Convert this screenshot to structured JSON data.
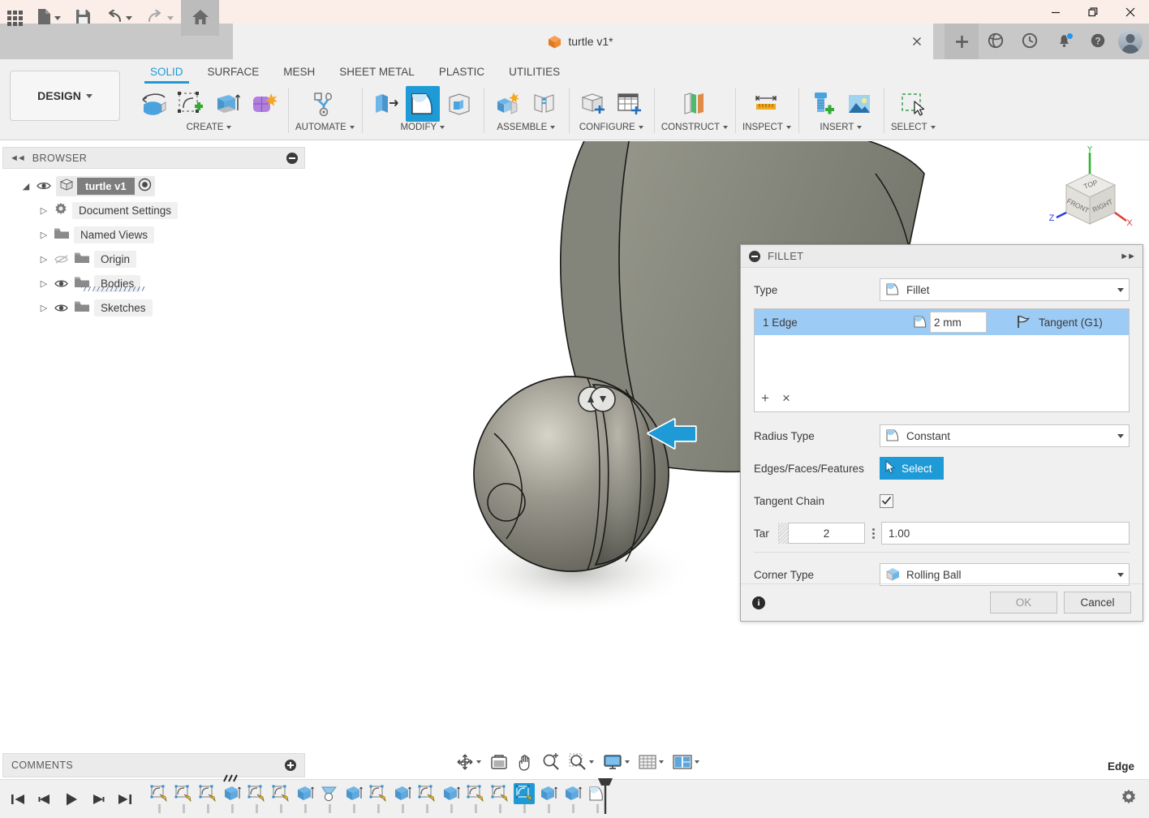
{
  "window": {
    "controls": [
      {
        "name": "minimize-button",
        "glyph": "minimize-icon"
      },
      {
        "name": "restore-button",
        "glyph": "restore-icon"
      },
      {
        "name": "close-button",
        "glyph": "close-icon"
      }
    ]
  },
  "quick_access": {
    "items": [
      {
        "name": "app-grid-button",
        "icon": "grid-apps-icon"
      },
      {
        "name": "new-file-button",
        "icon": "file-icon",
        "has_caret": true
      },
      {
        "name": "save-button",
        "icon": "save-disk-icon"
      },
      {
        "name": "undo-button",
        "icon": "undo-arrow-icon",
        "has_caret": true
      },
      {
        "name": "redo-button",
        "icon": "redo-arrow-icon",
        "has_caret": true
      },
      {
        "name": "home-button",
        "icon": "home-icon"
      }
    ],
    "right_items": [
      {
        "name": "new-tab-button",
        "icon": "plus-icon"
      },
      {
        "name": "data-panel-button",
        "icon": "globe-icon"
      },
      {
        "name": "job-status-button",
        "icon": "clock-icon"
      },
      {
        "name": "notifications-button",
        "icon": "bell-icon",
        "badge": true
      },
      {
        "name": "help-button",
        "icon": "question-mark-icon"
      },
      {
        "name": "account-avatar",
        "icon": "avatar-icon"
      }
    ]
  },
  "document_tab": {
    "title": "turtle v1*",
    "icon": "orange-cube-icon",
    "close_label": "×"
  },
  "ribbon": {
    "workspace": "DESIGN",
    "tabs": [
      {
        "label": "SOLID",
        "active": true
      },
      {
        "label": "SURFACE",
        "active": false
      },
      {
        "label": "MESH",
        "active": false
      },
      {
        "label": "SHEET METAL",
        "active": false
      },
      {
        "label": "PLASTIC",
        "active": false
      },
      {
        "label": "UTILITIES",
        "active": false
      }
    ],
    "groups": [
      {
        "name": "CREATE",
        "tools": [
          {
            "name": "revolve-tool",
            "icon": "revolve-icon",
            "active": false
          },
          {
            "name": "create-sketch-tool",
            "icon": "sketch-plus-icon",
            "active": false
          },
          {
            "name": "extrude-tool",
            "icon": "extrude-icon",
            "active": false
          },
          {
            "name": "form-tool",
            "icon": "form-sculpt-icon",
            "active": false
          }
        ]
      },
      {
        "name": "AUTOMATE",
        "tools": [
          {
            "name": "automate-tool",
            "icon": "automate-node-icon",
            "active": false
          }
        ]
      },
      {
        "name": "MODIFY",
        "tools": [
          {
            "name": "press-pull-tool",
            "icon": "press-pull-icon",
            "active": false
          },
          {
            "name": "fillet-tool",
            "icon": "fillet-icon",
            "active": true
          },
          {
            "name": "shell-tool",
            "icon": "shell-icon",
            "active": false
          }
        ]
      },
      {
        "name": "ASSEMBLE",
        "tools": [
          {
            "name": "new-component-tool",
            "icon": "new-component-icon",
            "active": false
          },
          {
            "name": "joint-tool",
            "icon": "joint-icon",
            "active": false
          }
        ]
      },
      {
        "name": "CONFIGURE",
        "tools": [
          {
            "name": "configure-tool",
            "icon": "configure-box-icon",
            "active": false
          },
          {
            "name": "config-table-tool",
            "icon": "config-table-icon",
            "active": false
          }
        ]
      },
      {
        "name": "CONSTRUCT",
        "tools": [
          {
            "name": "offset-plane-tool",
            "icon": "offset-plane-icon",
            "active": false
          }
        ]
      },
      {
        "name": "INSPECT",
        "tools": [
          {
            "name": "measure-tool",
            "icon": "measure-ruler-icon",
            "active": false
          }
        ]
      },
      {
        "name": "INSERT",
        "tools": [
          {
            "name": "insert-mcmaster-tool",
            "icon": "bolt-plus-icon",
            "active": false
          },
          {
            "name": "insert-image-tool",
            "icon": "image-icon",
            "active": false
          }
        ]
      },
      {
        "name": "SELECT",
        "tools": [
          {
            "name": "select-tool",
            "icon": "select-cursor-icon",
            "active": false
          }
        ]
      }
    ]
  },
  "browser": {
    "title": "BROWSER",
    "collapse_icon": "collapse-left-icon",
    "minimize_icon": "minus-circle-icon",
    "root": {
      "label": "turtle v1",
      "visible": true,
      "icon": "component-icon",
      "activate_icon": "radio-dot-icon"
    },
    "items": [
      {
        "label": "Document Settings",
        "icon": "gear-icon",
        "has_eye": false,
        "visible": true
      },
      {
        "label": "Named Views",
        "icon": "folder-icon",
        "has_eye": false,
        "visible": true
      },
      {
        "label": "Origin",
        "icon": "folder-icon",
        "has_eye": true,
        "visible": false
      },
      {
        "label": "Bodies",
        "icon": "folder-icon",
        "has_eye": true,
        "visible": true,
        "hatched": true
      },
      {
        "label": "Sketches",
        "icon": "folder-icon",
        "has_eye": true,
        "visible": true
      }
    ]
  },
  "dialog": {
    "title": "FILLET",
    "collapse_icon": "minus-circle-icon",
    "expand_icon": "expand-right-icon",
    "type": {
      "label": "Type",
      "value": "Fillet",
      "icon": "fillet-icon"
    },
    "selection_row": {
      "edge_count": "1 Edge",
      "radius_value": "2 mm",
      "radius_icon": "fillet-icon",
      "continuity": "Tangent (G1)",
      "continuity_icon": "tangent-flag-icon"
    },
    "list_buttons": [
      {
        "name": "add-selection-button",
        "glyph": "+"
      },
      {
        "name": "remove-selection-button",
        "glyph": "×"
      }
    ],
    "radius_type": {
      "label": "Radius Type",
      "value": "Constant",
      "icon": "fillet-icon"
    },
    "selection": {
      "label": "Edges/Faces/Features",
      "button": "Select",
      "icon": "cursor-arrow-icon"
    },
    "tangent_chain": {
      "label": "Tangent Chain",
      "checked": true
    },
    "partial_row": {
      "clipped_label": "Tar",
      "count_value": "2",
      "ratio_value": "1.00"
    },
    "corner_type": {
      "label": "Corner Type",
      "value": "Rolling Ball",
      "icon": "rolling-ball-icon"
    },
    "footer": {
      "info_icon": "info-circle-icon",
      "ok_label": "OK",
      "cancel_label": "Cancel"
    }
  },
  "viewport": {
    "background": "#ffffff",
    "model_color": "#8a8b80",
    "viewcube": {
      "faces": [
        "TOP",
        "FRONT",
        "RIGHT"
      ],
      "axes": [
        {
          "label": "X",
          "color": "#e03a3a"
        },
        {
          "label": "Y",
          "color": "#2fb62f"
        },
        {
          "label": "Z",
          "color": "#2b3fe0"
        }
      ]
    },
    "cursor": {
      "icon": "blue-arrow-cursor-icon"
    },
    "manipulator": {
      "icon": "dual-arrow-handle-icon"
    }
  },
  "comments": {
    "title": "COMMENTS",
    "add_icon": "plus-circle-icon"
  },
  "navbar": {
    "items": [
      {
        "name": "orbit-button",
        "icon": "orbit-icon",
        "has_caret": true
      },
      {
        "name": "look-at-button",
        "icon": "look-at-icon",
        "has_caret": false
      },
      {
        "name": "pan-button",
        "icon": "pan-hand-icon",
        "has_caret": false
      },
      {
        "name": "zoom-button",
        "icon": "zoom-in-icon",
        "has_caret": false
      },
      {
        "name": "zoom-window-button",
        "icon": "zoom-window-icon",
        "has_caret": true
      },
      {
        "name": "display-settings-button",
        "icon": "monitor-icon",
        "has_caret": true
      },
      {
        "name": "grid-snaps-button",
        "icon": "grid-icon",
        "has_caret": true
      },
      {
        "name": "viewports-button",
        "icon": "viewports-icon",
        "has_caret": true
      }
    ]
  },
  "status": {
    "selection_filter": "Edge"
  },
  "timeline": {
    "playback": [
      {
        "name": "go-to-beginning-button",
        "icon": "skip-start-icon"
      },
      {
        "name": "step-back-button",
        "icon": "step-back-icon"
      },
      {
        "name": "play-button",
        "icon": "play-icon"
      },
      {
        "name": "step-forward-button",
        "icon": "step-forward-icon"
      },
      {
        "name": "go-to-end-button",
        "icon": "skip-end-icon"
      }
    ],
    "features": [
      {
        "name": "sketch-feature",
        "icon": "sketch-icon",
        "active": false
      },
      {
        "name": "sketch-feature",
        "icon": "sketch-icon",
        "active": false
      },
      {
        "name": "sketch-feature",
        "icon": "sketch-icon",
        "active": false
      },
      {
        "name": "extrude-feature",
        "icon": "extrude-icon",
        "active": false,
        "marked": true
      },
      {
        "name": "sketch-feature",
        "icon": "sketch-icon",
        "active": false
      },
      {
        "name": "sketch-feature",
        "icon": "sketch-icon",
        "active": false
      },
      {
        "name": "extrude-feature",
        "icon": "extrude-icon",
        "active": false
      },
      {
        "name": "revolve-feature",
        "icon": "revolve-icon",
        "active": false
      },
      {
        "name": "loft-feature",
        "icon": "loft-icon",
        "active": false
      },
      {
        "name": "extrude-feature",
        "icon": "extrude-icon",
        "active": false
      },
      {
        "name": "sketch-feature",
        "icon": "sketch-icon",
        "active": false
      },
      {
        "name": "extrude-feature",
        "icon": "extrude-icon",
        "active": false
      },
      {
        "name": "sketch-feature",
        "icon": "sketch-icon",
        "active": false
      },
      {
        "name": "extrude-feature",
        "icon": "extrude-icon",
        "active": false
      },
      {
        "name": "sketch-feature",
        "icon": "sketch-icon",
        "active": false
      },
      {
        "name": "sketch-feature",
        "icon": "sketch-icon",
        "active": false
      },
      {
        "name": "sketch-feature",
        "icon": "sketch-icon",
        "active": true
      },
      {
        "name": "extrude-feature",
        "icon": "extrude-icon",
        "active": false
      },
      {
        "name": "extrude-feature",
        "icon": "extrude-icon",
        "active": false
      },
      {
        "name": "fillet-feature",
        "icon": "fillet-icon",
        "active": false
      }
    ],
    "settings_icon": "gear-icon"
  }
}
